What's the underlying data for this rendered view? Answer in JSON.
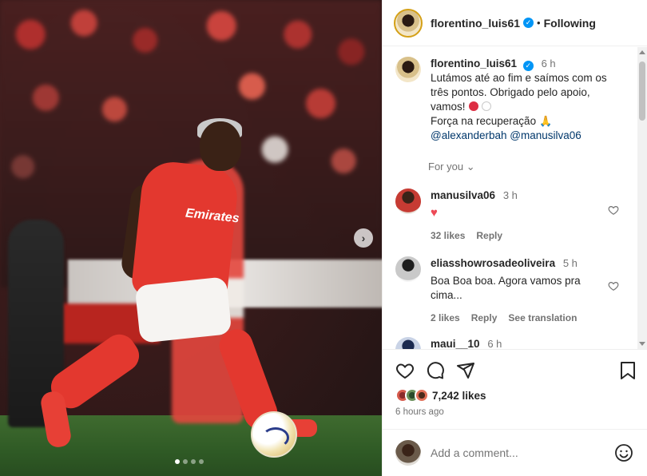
{
  "post": {
    "username": "florentino_luis61",
    "follow_state": "Following",
    "separator": "•",
    "jersey_text": "Emirates"
  },
  "caption": {
    "username": "florentino_luis61",
    "time": "6 h",
    "line1": "Lutámos até ao fim e saímos com os três pontos. Obrigado pelo apoio, vamos!",
    "line2": "Força na recuperação",
    "mentions": [
      "@alexanderbah",
      "@manusilva06"
    ]
  },
  "for_you": "For you",
  "comments": [
    {
      "username": "manusilva06",
      "time": "3 h",
      "likes": "32 likes",
      "reply": "Reply"
    },
    {
      "username": "eliasshowrosadeoliveira",
      "time": "5 h",
      "text": "Boa Boa boa. Agora vamos pra cima...",
      "likes": "2 likes",
      "reply": "Reply",
      "translate": "See translation"
    },
    {
      "username": "maui__10",
      "time": "6 h"
    }
  ],
  "engagement": {
    "likes": "7,242 likes",
    "posted": "6 hours ago"
  },
  "add_comment": {
    "placeholder": "Add a comment..."
  },
  "carousel": {
    "total": 4,
    "active": 1
  },
  "colors": {
    "verified": "#0095f6",
    "mention": "#00376b",
    "like": "#ed4956",
    "kit_red": "#e3382f"
  }
}
